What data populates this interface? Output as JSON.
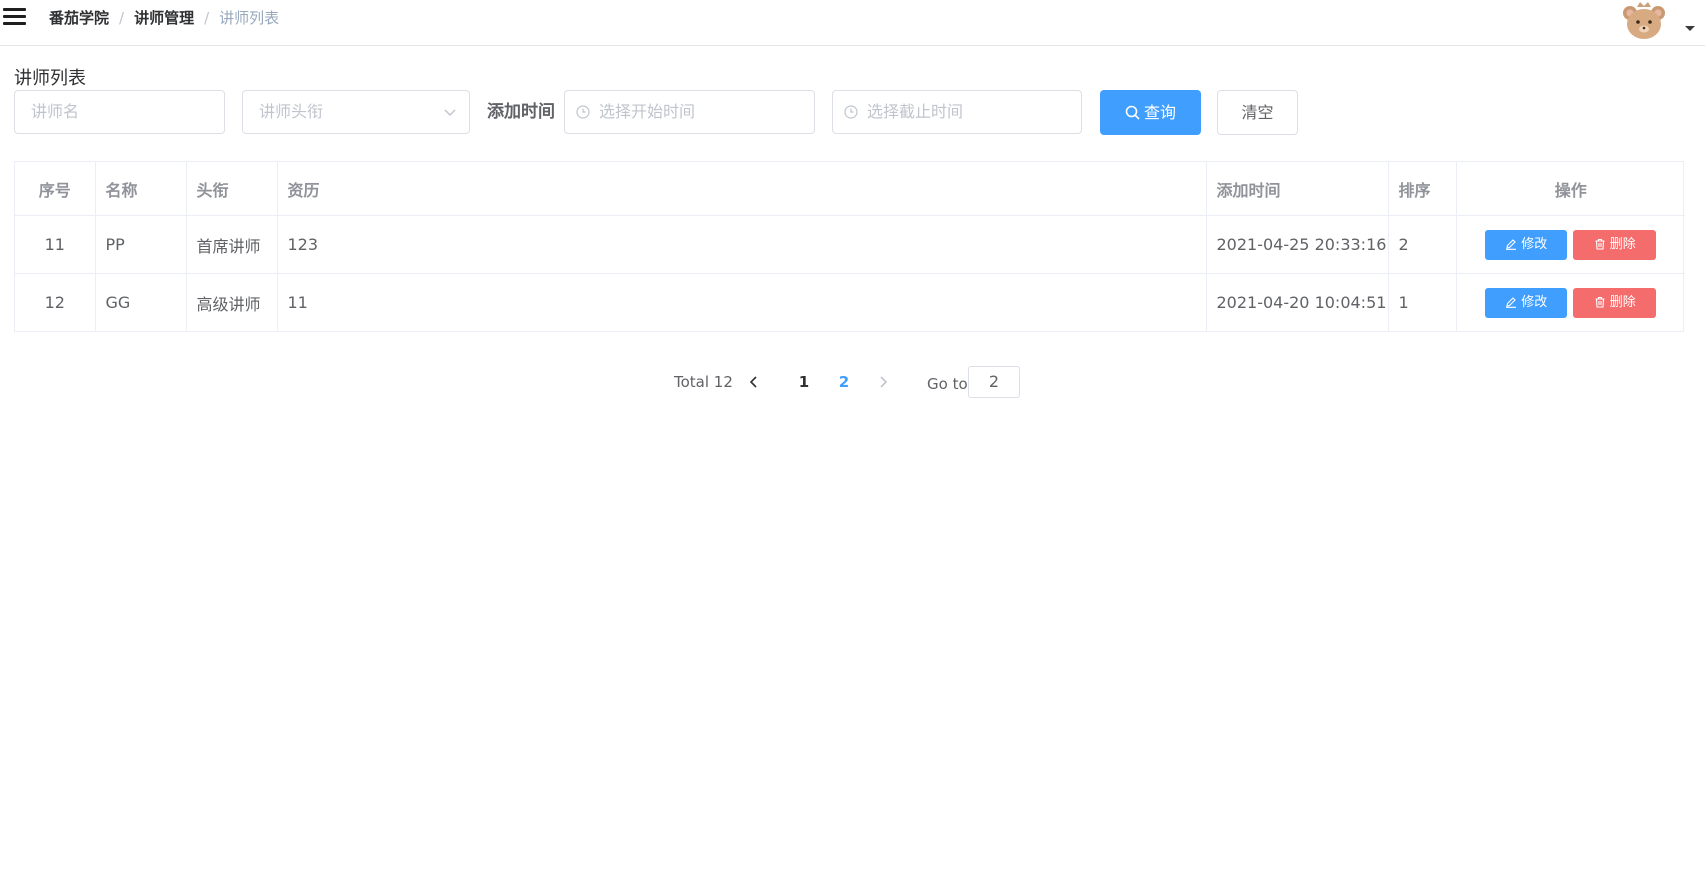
{
  "navbar": {
    "breadcrumb": [
      "番茄学院",
      "讲师管理",
      "讲师列表"
    ],
    "separator": "/"
  },
  "page": {
    "title": "讲师列表"
  },
  "filters": {
    "name_placeholder": "讲师名",
    "level_placeholder": "讲师头衔",
    "time_label": "添加时间",
    "start_placeholder": "选择开始时间",
    "end_placeholder": "选择截止时间",
    "query_label": "查询",
    "clear_label": "清空"
  },
  "table": {
    "columns": [
      "序号",
      "名称",
      "头衔",
      "资历",
      "添加时间",
      "排序",
      "操作"
    ],
    "rows": [
      {
        "index": "11",
        "name": "PP",
        "level": "首席讲师",
        "intro": "123",
        "time": "2021-04-25 20:33:16",
        "sort": "2"
      },
      {
        "index": "12",
        "name": "GG",
        "level": "高级讲师",
        "intro": "11",
        "time": "2021-04-20 10:04:51",
        "sort": "1"
      }
    ],
    "edit_label": "修改",
    "delete_label": "删除"
  },
  "pagination": {
    "total": "Total 12",
    "pages": [
      "1",
      "2"
    ],
    "current_page": "2",
    "goto_label": "Go to",
    "goto_value": "2"
  },
  "colors": {
    "primary": "#409eff",
    "danger": "#f56c6c",
    "border": "#dcdfe6"
  },
  "icons": [
    "menu-icon",
    "avatar-icon",
    "caret-down-icon",
    "chevron-down-icon",
    "clock-icon",
    "search-icon",
    "edit-icon",
    "trash-icon",
    "chevron-left-icon",
    "chevron-right-icon"
  ]
}
